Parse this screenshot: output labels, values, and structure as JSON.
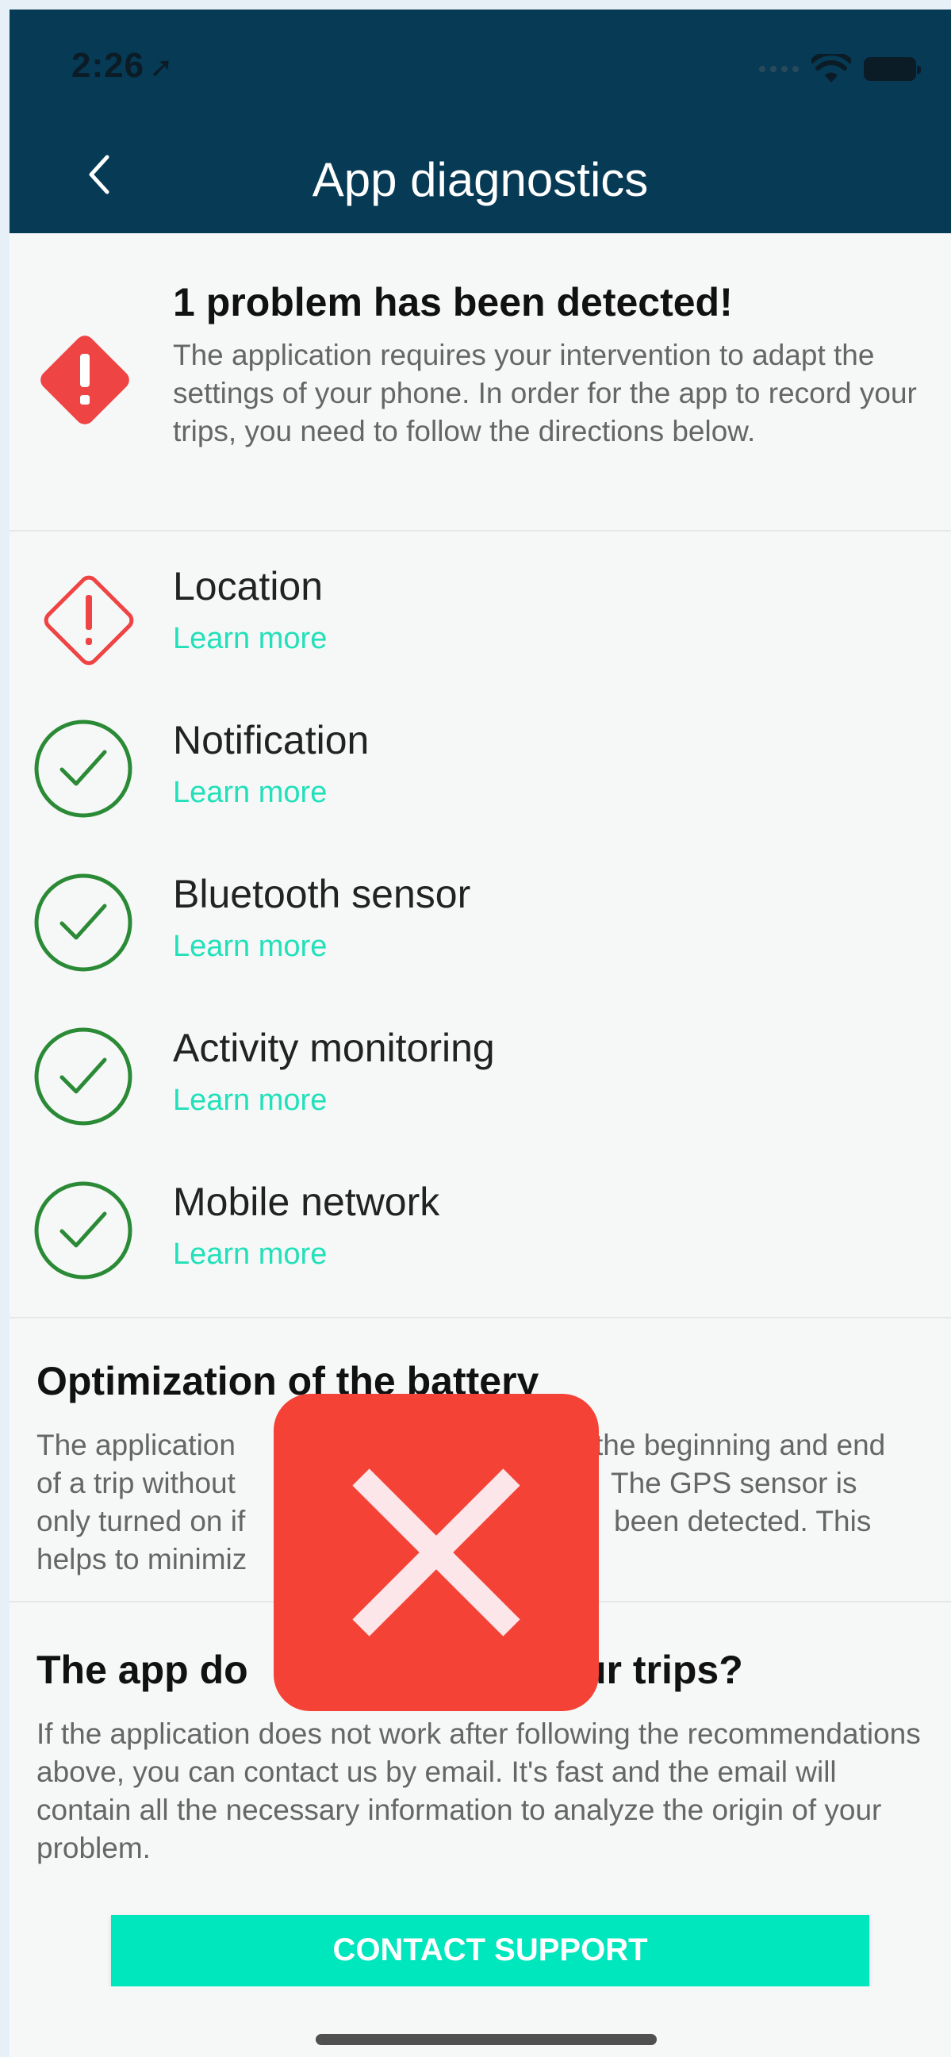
{
  "status_bar": {
    "time": "2:26"
  },
  "header": {
    "title": "App diagnostics"
  },
  "problem": {
    "title": "1 problem has been detected!",
    "description": "The application requires your intervention to adapt the settings of your phone. In order for the app to record your trips, you need to follow the directions below."
  },
  "checks": [
    {
      "label": "Location",
      "link": "Learn more",
      "status": "warning"
    },
    {
      "label": "Notification",
      "link": "Learn more",
      "status": "ok"
    },
    {
      "label": "Bluetooth sensor",
      "link": "Learn more",
      "status": "ok"
    },
    {
      "label": "Activity monitoring",
      "link": "Learn more",
      "status": "ok"
    },
    {
      "label": "Mobile network",
      "link": "Learn more",
      "status": "ok"
    }
  ],
  "battery": {
    "title": "Optimization of the battery",
    "line1_left": "The application",
    "line1_right": "the beginning and end",
    "line2_left": "of a trip without",
    "line2_right": "The GPS sensor is",
    "line3_left": "only turned on if",
    "line3_right": "been detected. This",
    "line4_left": "helps to minimiz"
  },
  "support": {
    "title_left": "The app do",
    "title_right": "ur trips?",
    "description": "If the application does not work after following the recommendations above, you can contact us by email. It's fast and the email will contain all the necessary information to analyze the origin of your problem.",
    "button": "CONTACT SUPPORT"
  },
  "colors": {
    "header_bg": "#063a55",
    "accent": "#22e0b9",
    "button": "#00e6bd",
    "warning": "#ef4444",
    "ok": "#2b8a35",
    "overlay": "#f44336"
  },
  "icons": {
    "back": "chevron-left-icon",
    "problem": "warning-diamond-filled-icon",
    "warning": "warning-diamond-outline-icon",
    "ok": "check-circle-icon",
    "overlay": "close-icon"
  }
}
